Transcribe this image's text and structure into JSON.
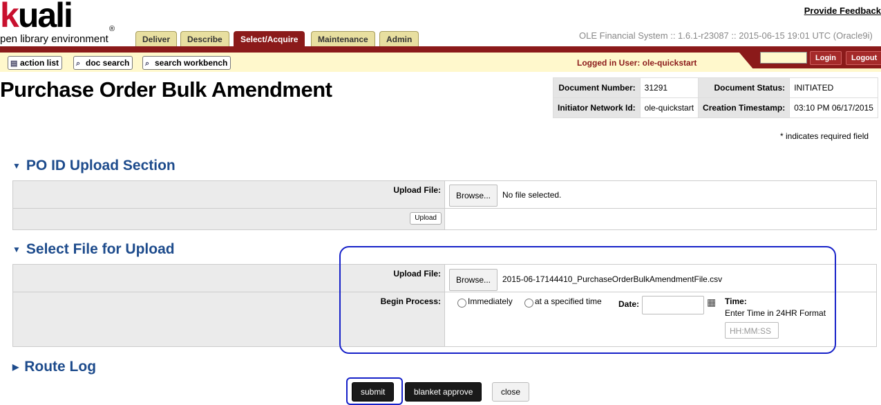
{
  "brand": {
    "logo_k": "k",
    "logo_rest": "uali",
    "reg": "®",
    "tagline": "pen library environment"
  },
  "header": {
    "feedback": "Provide Feedback",
    "system_info": "OLE Financial System :: 1.6.1-r23087 :: 2015-06-15 19:01 UTC (Oracle9i)",
    "tabs": [
      {
        "label": "Deliver"
      },
      {
        "label": "Describe"
      },
      {
        "label": "Select/Acquire",
        "active": true
      },
      {
        "label": "Maintenance"
      },
      {
        "label": "Admin"
      }
    ],
    "nav": {
      "action_list": "action list",
      "doc_search": "doc search",
      "search_workbench": "search workbench"
    },
    "logged_in": "Logged in User: ole-quickstart",
    "login": "Login",
    "logout": "Logout"
  },
  "page": {
    "title": "Purchase Order Bulk Amendment",
    "required_note": "* indicates required field"
  },
  "doc_info": {
    "doc_number_label": "Document Number:",
    "doc_number": "31291",
    "doc_status_label": "Document Status:",
    "doc_status": "INITIATED",
    "initiator_label": "Initiator Network Id:",
    "initiator": "ole-quickstart",
    "created_label": "Creation Timestamp:",
    "created": "03:10 PM 06/17/2015"
  },
  "po_upload": {
    "title": "PO ID Upload Section",
    "file_label": "Upload File:",
    "browse": "Browse...",
    "file_value": "No file selected.",
    "upload_button": "Upload"
  },
  "file_upload": {
    "title": "Select File for Upload",
    "file_label": "Upload File:",
    "browse": "Browse...",
    "file_value": "2015-06-17144410_PurchaseOrderBulkAmendmentFile.csv",
    "begin_label": "Begin Process:",
    "opt_immediately": "Immediately",
    "opt_specified": "at a specified time",
    "date_label": "Date:",
    "time_label": "Time:",
    "time_hint": "Enter Time in 24HR Format",
    "time_placeholder": "HH:MM:SS"
  },
  "route_log": {
    "title": "Route Log"
  },
  "footer": {
    "submit": "submit",
    "blanket_approve": "blanket approve",
    "close": "close"
  },
  "colors": {
    "brand_red": "#8b1a1a",
    "section_blue": "#1d4b8c",
    "highlight": "#1520c8"
  }
}
